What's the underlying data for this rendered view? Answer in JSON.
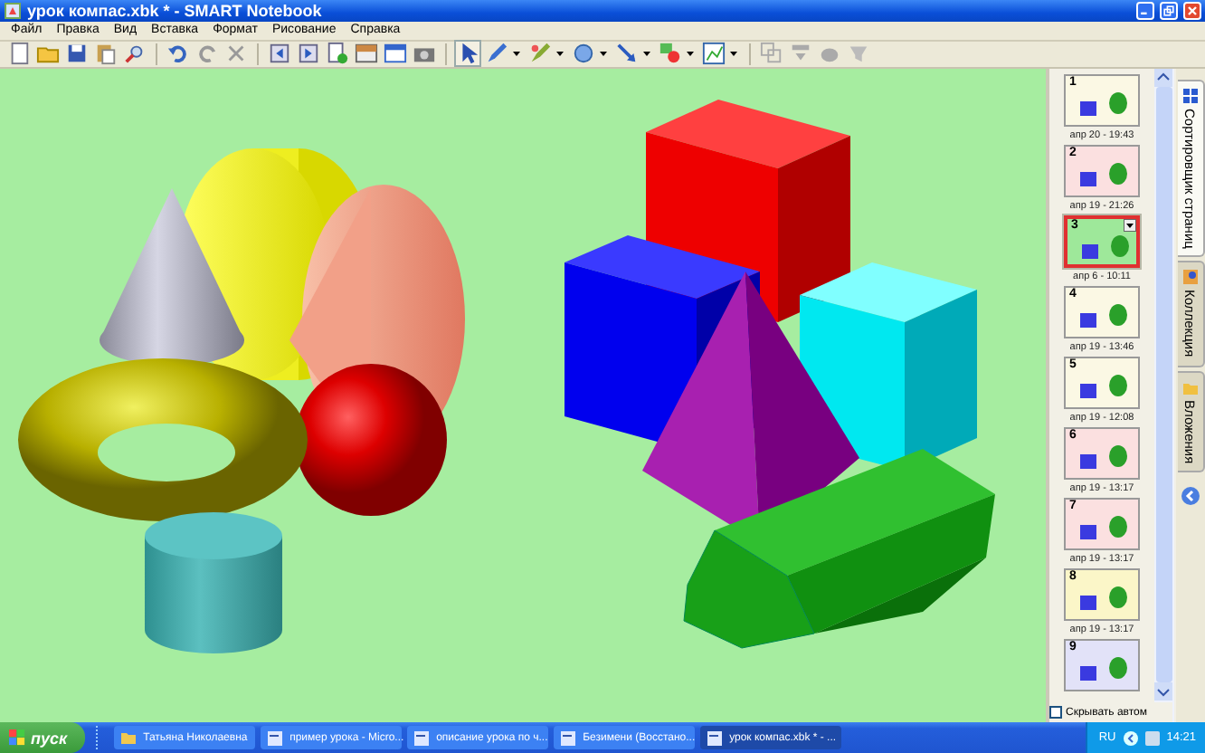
{
  "window": {
    "title": "урок компас.xbk * - SMART Notebook"
  },
  "menu": [
    "Файл",
    "Правка",
    "Вид",
    "Вставка",
    "Формат",
    "Рисование",
    "Справка"
  ],
  "page_sorter": {
    "pages": [
      {
        "number": "1",
        "label": "апр 20 - 19:43",
        "color": "#fbf8e4",
        "selected": false
      },
      {
        "number": "2",
        "label": "апр 19 - 21:26",
        "color": "#fbe0e0",
        "selected": false
      },
      {
        "number": "3",
        "label": "апр 6 - 10:11",
        "color": "#9ee89a",
        "selected": true
      },
      {
        "number": "4",
        "label": "апр 19 - 13:46",
        "color": "#fbf8e4",
        "selected": false
      },
      {
        "number": "5",
        "label": "апр 19 - 12:08",
        "color": "#fbf8e4",
        "selected": false
      },
      {
        "number": "6",
        "label": "апр 19 - 13:17",
        "color": "#fbe0e0",
        "selected": false
      },
      {
        "number": "7",
        "label": "апр 19 - 13:17",
        "color": "#fbe0e0",
        "selected": false
      },
      {
        "number": "8",
        "label": "апр 19 - 13:17",
        "color": "#fbf6c8",
        "selected": false
      },
      {
        "number": "9",
        "color": "#e2e2f8",
        "selected": false
      }
    ],
    "hide_automatically": {
      "label": "Скрывать автом",
      "checked": false
    }
  },
  "side_tabs": [
    {
      "label": "Сортировщик страниц",
      "selected": true
    },
    {
      "label": "Коллекция",
      "selected": false
    },
    {
      "label": "Вложения",
      "selected": false
    }
  ],
  "taskbar": {
    "start": "пуск",
    "tasks": [
      {
        "label": "Татьяна Николаевна",
        "selected": false
      },
      {
        "label": "пример урока - Micro...",
        "selected": false
      },
      {
        "label": "описание урока по ч...",
        "selected": false
      },
      {
        "label": "Безимени (Восстано...",
        "selected": false
      },
      {
        "label": "урок компас.xbk * - ...",
        "selected": true
      }
    ],
    "language": "RU",
    "clock": "14:21"
  }
}
